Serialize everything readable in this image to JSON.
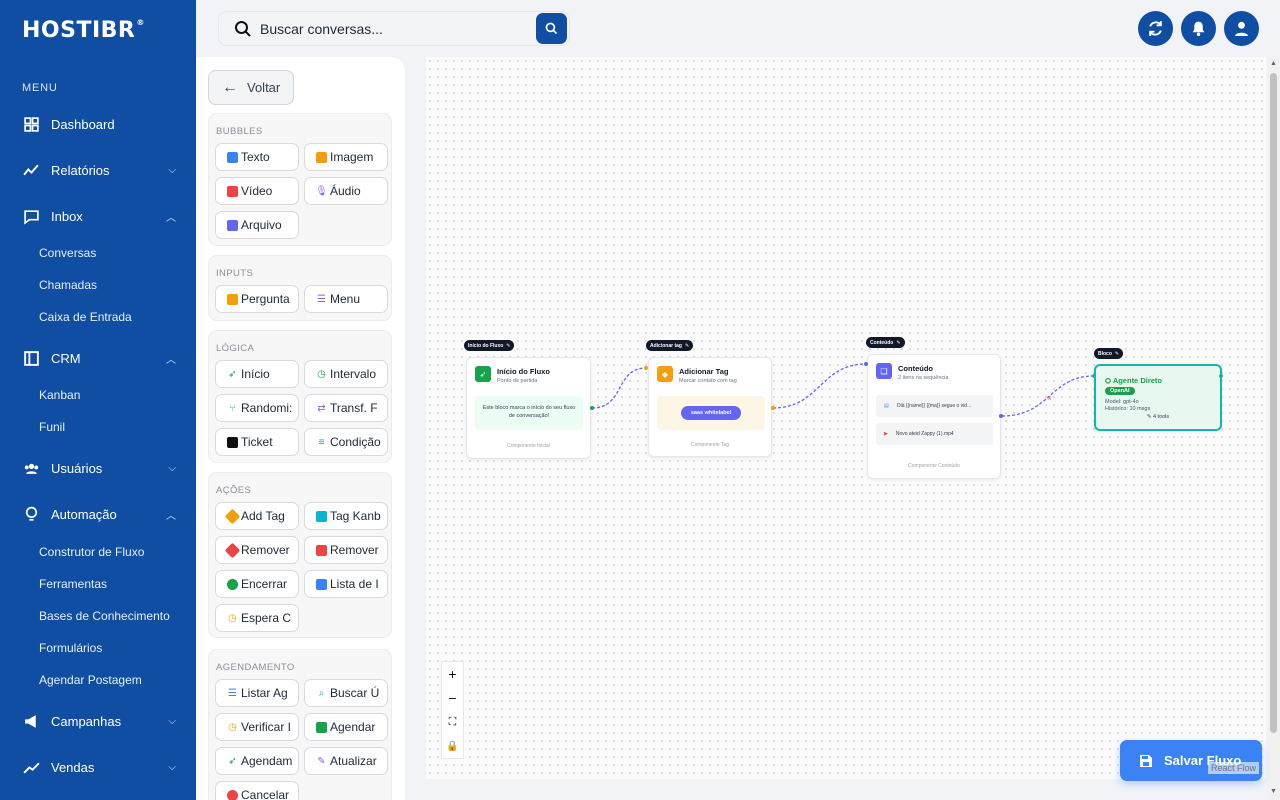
{
  "brand": {
    "logo": "HOSTIBR",
    "registered": "®"
  },
  "colors": {
    "primary": "#0f4ea3",
    "accent": "#3b82f6",
    "sidebar_bg": "#0f4ea3"
  },
  "sidebar": {
    "menu_title": "MENU",
    "items": [
      {
        "label": "Dashboard",
        "icon": "dashboard-icon"
      },
      {
        "label": "Relatórios",
        "icon": "chart-line-icon",
        "chevron": "down"
      },
      {
        "label": "Inbox",
        "icon": "chat-icon",
        "chevron": "up"
      },
      {
        "label": "CRM",
        "icon": "crm-icon",
        "chevron": "up"
      },
      {
        "label": "Usuários",
        "icon": "users-icon",
        "chevron": "down"
      },
      {
        "label": "Automação",
        "icon": "bulb-icon",
        "chevron": "up"
      },
      {
        "label": "Campanhas",
        "icon": "megaphone-icon",
        "chevron": "down"
      },
      {
        "label": "Vendas",
        "icon": "trend-icon",
        "chevron": "down"
      }
    ],
    "inbox_sub": [
      "Conversas",
      "Chamadas",
      "Caixa de Entrada"
    ],
    "crm_sub": [
      "Kanban",
      "Funil"
    ],
    "automacao_sub": [
      "Construtor de Fluxo",
      "Ferramentas",
      "Bases de Conhecimento",
      "Formulários",
      "Agendar Postagem"
    ]
  },
  "search": {
    "placeholder": "Buscar conversas..."
  },
  "panel": {
    "back_label": "Voltar",
    "sections": [
      {
        "title": "BUBBLES",
        "items": [
          "Texto",
          "Imagem",
          "Vídeo",
          "Áudio",
          "Arquivo"
        ]
      },
      {
        "title": "INPUTS",
        "items": [
          "Pergunta",
          "Menu"
        ]
      },
      {
        "title": "LÓGICA",
        "items": [
          "Início",
          "Intervalo",
          "Randomi:",
          "Transf. F",
          "Ticket",
          "Condição"
        ]
      },
      {
        "title": "AÇÕES",
        "items": [
          "Add Tag",
          "Tag Kanb",
          "Remover",
          "Remover",
          "Encerrar",
          "Lista de I",
          "Espera C"
        ]
      },
      {
        "title": "AGENDAMENTO",
        "items": [
          "Listar Ag",
          "Buscar Ú",
          "Verificar I",
          "Agendar",
          "Agendam",
          "Atualizar",
          "Cancelar"
        ]
      }
    ]
  },
  "flow": {
    "start": {
      "tag": "Início do Fluxo",
      "title": "Início do Fluxo",
      "subtitle": "Ponto de partida",
      "body": "Este bloco marca o início do seu fluxo de conversação!",
      "footer": "Componente Inicial"
    },
    "tag": {
      "tag": "Adicionar tag",
      "title": "Adicionar Tag",
      "subtitle": "Marcar contato com tag",
      "pill": "saas whitelabel",
      "footer": "Componente Tag"
    },
    "content": {
      "tag": "Conteúdo",
      "title": "Conteúdo",
      "subtitle": "2 itens na sequência",
      "item1": "Olá {{name}} {{ma}} segue o vid...",
      "item2": "Novo ateid Zappy (1).mp4",
      "footer": "Componente Conteúdo"
    },
    "agent": {
      "tag": "Bloco",
      "title": "Agente Direto",
      "badge": "OpenAI",
      "model": "Model: gpt-4o",
      "history": "Histórico: 10 msgs",
      "tools": "4 tools"
    }
  },
  "controls": {
    "zoom_in": "+",
    "zoom_out": "−"
  },
  "save_label": "Salvar Fluxo",
  "attribution": "React Flow"
}
